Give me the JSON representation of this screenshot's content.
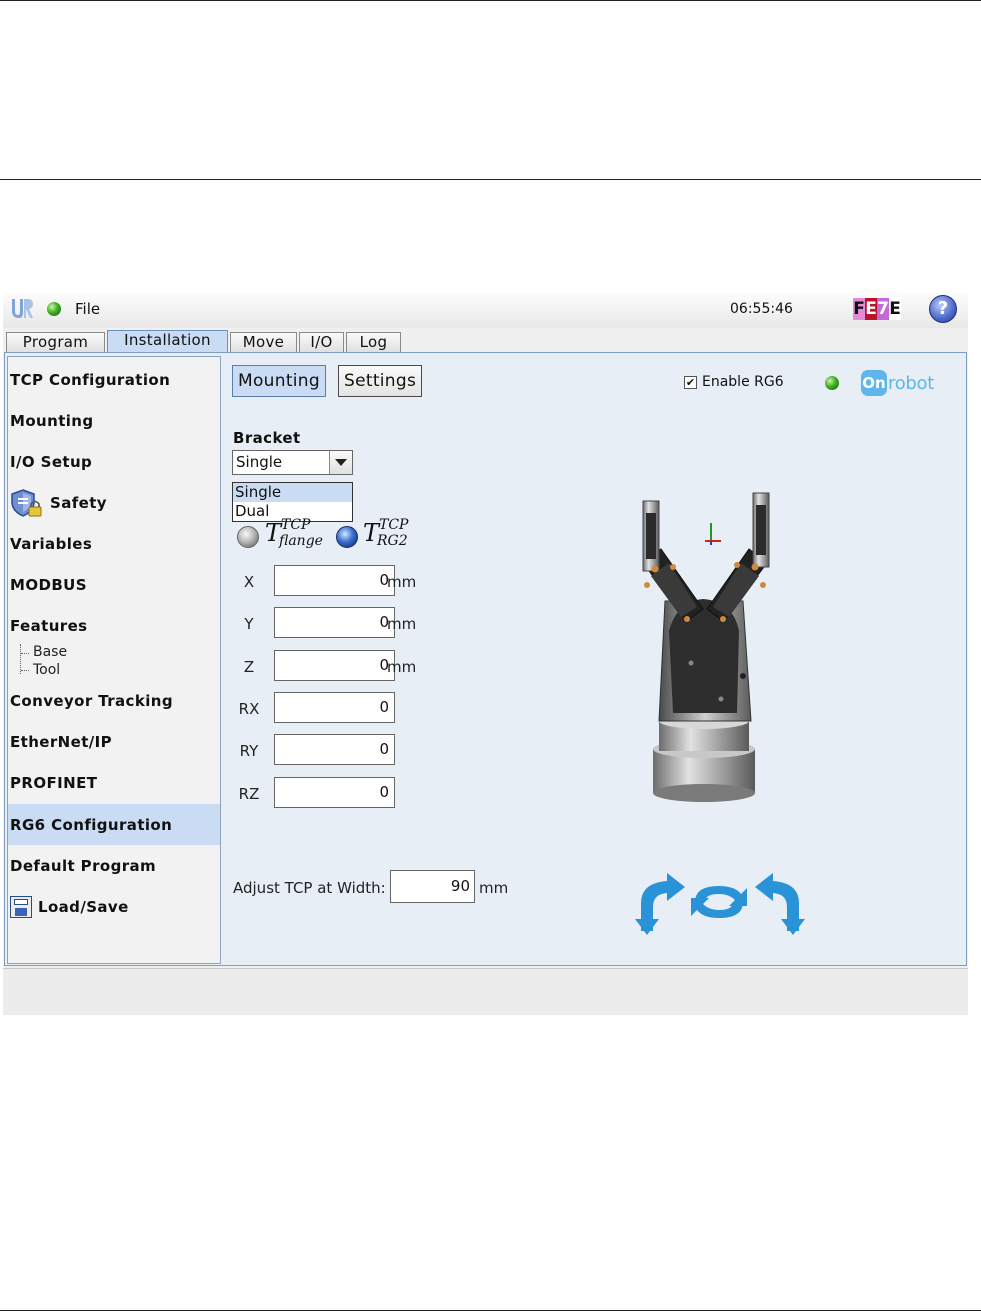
{
  "topbar": {
    "file_label": "File",
    "time": "06:55:46",
    "badge_letters": [
      "F",
      "E",
      "7",
      "E"
    ],
    "help_label": "?"
  },
  "tabs": [
    {
      "label": "Program",
      "active": false
    },
    {
      "label": "Installation",
      "active": true
    },
    {
      "label": "Move",
      "active": false
    },
    {
      "label": "I/O",
      "active": false
    },
    {
      "label": "Log",
      "active": false
    }
  ],
  "sidebar": {
    "items": [
      {
        "label": "TCP Configuration"
      },
      {
        "label": "Mounting"
      },
      {
        "label": "I/O Setup"
      },
      {
        "label": "Safety",
        "icon": "shield-lock-icon"
      },
      {
        "label": "Variables"
      },
      {
        "label": "MODBUS"
      },
      {
        "label": "Features"
      },
      {
        "label": "Conveyor Tracking"
      },
      {
        "label": "EtherNet/IP"
      },
      {
        "label": "PROFINET"
      },
      {
        "label": "RG6 Configuration",
        "selected": true
      },
      {
        "label": "Default Program"
      },
      {
        "label": "Load/Save",
        "icon": "floppy-disk-icon"
      }
    ],
    "feature_children": [
      "Base",
      "Tool"
    ]
  },
  "main": {
    "subtabs": [
      {
        "label": "Mounting",
        "active": true
      },
      {
        "label": "Settings",
        "active": false
      }
    ],
    "enable_label": "Enable RG6",
    "enable_checked": true,
    "brand_mark": "On",
    "brand_text": "robot",
    "bracket": {
      "label": "Bracket",
      "selected": "Single",
      "options": [
        "Single",
        "Dual"
      ]
    },
    "tcp_options": [
      {
        "symbol": "T",
        "sup": "TCP",
        "sub": "flange",
        "selected": false
      },
      {
        "symbol": "T",
        "sup": "TCP",
        "sub": "RG2",
        "selected": true
      }
    ],
    "coords": [
      {
        "label": "X",
        "value": "0",
        "unit": "mm"
      },
      {
        "label": "Y",
        "value": "0",
        "unit": "mm"
      },
      {
        "label": "Z",
        "value": "0",
        "unit": "mm"
      },
      {
        "label": "RX",
        "value": "0",
        "unit": ""
      },
      {
        "label": "RY",
        "value": "0",
        "unit": ""
      },
      {
        "label": "RZ",
        "value": "0",
        "unit": ""
      }
    ],
    "adjust": {
      "label": "Adjust TCP at Width:",
      "value": "90",
      "unit": "mm"
    }
  },
  "colors": {
    "selection": "#c9dcf3",
    "status_green": "#3fae22",
    "onrobot_blue": "#5fb6ea",
    "rotate_arrow_blue": "#2a93d8"
  }
}
